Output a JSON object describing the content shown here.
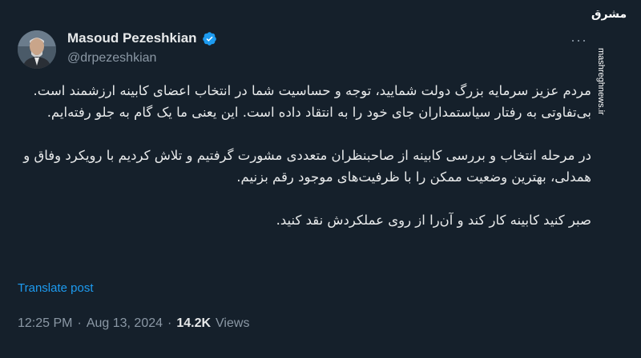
{
  "watermark": {
    "logo_text": "مشرق",
    "side_text": "mashreghnews.ir"
  },
  "author": {
    "display_name": "Masoud Pezeshkian",
    "handle": "@drpezeshkian",
    "verified_icon": "verified-badge-icon",
    "accent_color": "#1d9bf0"
  },
  "menu": {
    "more_label": "···"
  },
  "tweet": {
    "paragraphs": [
      "مردم عزیز سرمایه بزرگ دولت شمایید، توجه و حساسیت شما در انتخاب اعضای کابینه ارزشمند است. بی‌تفاوتی به رفتار سیاستمداران جای خود را به انتقاد داده است. این یعنی ما یک گام به جلو رفته‌ایم.",
      "در مرحله انتخاب و بررسی کابینه از صاحبنظران متعددی مشورت گرفتیم و تلاش کردیم با رویکرد وفاق و همدلی، بهترین وضعیت ممکن را با ظرفیت‌های موجود رقم بزنیم.",
      "صبر کنید کابینه کار کند و آن‌را از روی عملکردش نقد کنید."
    ],
    "translate_label": "Translate post"
  },
  "meta": {
    "time": "12:25 PM",
    "separator": "·",
    "date": "Aug 13, 2024",
    "views_count": "14.2K",
    "views_label": "Views"
  }
}
